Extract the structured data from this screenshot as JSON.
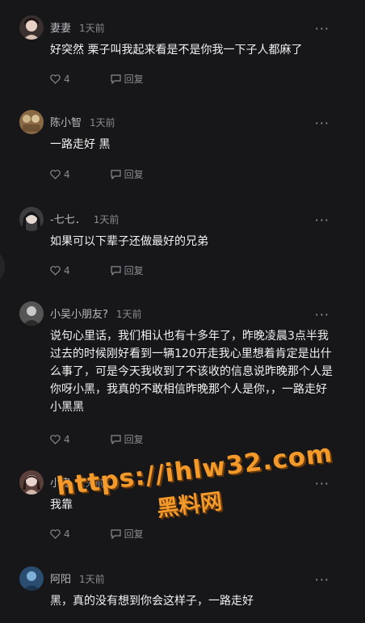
{
  "comments": [
    {
      "username": "妻妻",
      "time": "1天前",
      "text": "好突然 栗子叫我起来看是不是你我一下子人都麻了",
      "likes": "4",
      "reply_label": "回复",
      "avatar_colors": [
        "#3a3030",
        "#e9d0c4"
      ]
    },
    {
      "username": "陈小智",
      "time": "1天前",
      "text": "一路走好 黑",
      "likes": "4",
      "reply_label": "回复",
      "avatar_colors": [
        "#8a6a44",
        "#cdb58c"
      ]
    },
    {
      "username": "-七七．",
      "time": "1天前",
      "text": "如果可以下辈子还做最好的兄弟",
      "likes": "4",
      "reply_label": "回复",
      "avatar_colors": [
        "#3b3b40",
        "#e6d9d2"
      ]
    },
    {
      "username": "小吴小朋友?",
      "time": "1天前",
      "text": "说句心里话，我们相认也有十多年了，昨晚凌晨3点半我过去的时候刚好看到一辆120开走我心里想着肯定是出什么事了，可是今天我收到了不该收的信息说昨晚那个人是你呀小黑，我真的不敢相信昨晚那个人是你，，一路走好小黑黑",
      "likes": "4",
      "reply_label": "回复",
      "avatar_colors": [
        "#555",
        "#c9c9c9"
      ]
    },
    {
      "username": "小鬼",
      "time": "1天前",
      "text": "我靠",
      "likes": "4",
      "reply_label": "回复",
      "avatar_colors": [
        "#5a3f3a",
        "#e8d4cc"
      ]
    },
    {
      "username": "阿阳",
      "time": "1天前",
      "text": "黑，真的没有想到你会这样子，一路走好",
      "likes": "",
      "reply_label": "",
      "avatar_colors": [
        "#2a4d70",
        "#7fb0d8"
      ]
    }
  ],
  "more_label": "···",
  "watermark": {
    "url": "https://ihlw32.com",
    "name": "黑料网",
    "color": "#f39a2b"
  }
}
